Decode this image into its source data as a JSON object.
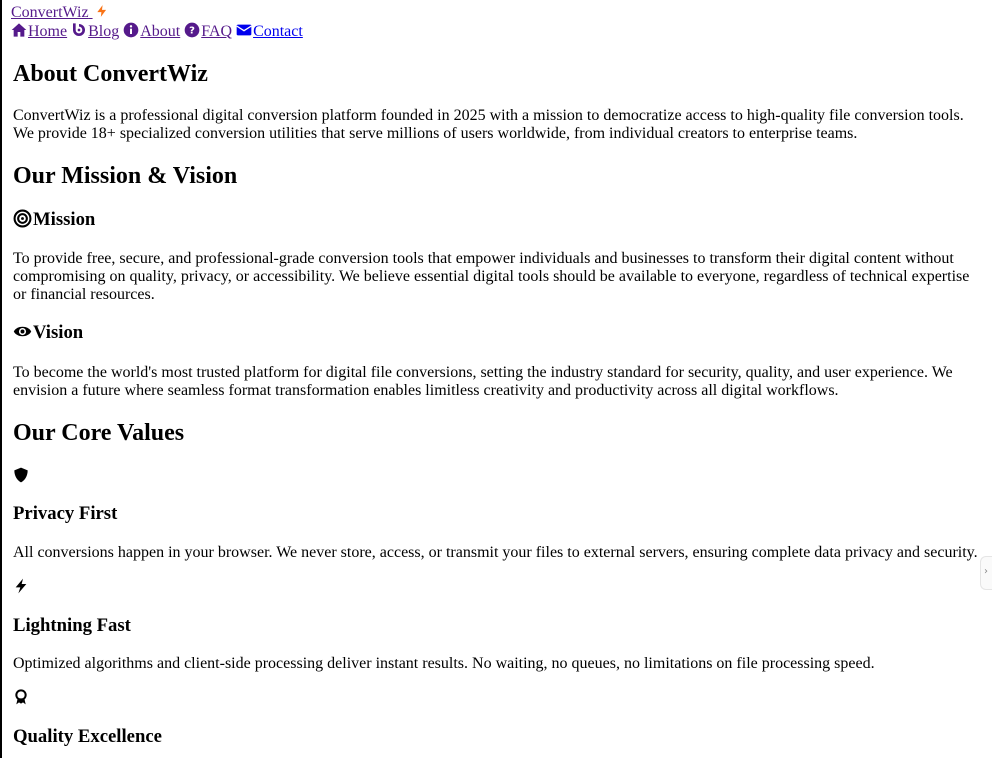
{
  "header": {
    "logo_text": "ConvertWiz",
    "nav": [
      {
        "label": "Home",
        "icon": "home-icon"
      },
      {
        "label": "Blog",
        "icon": "blog-icon"
      },
      {
        "label": "About",
        "icon": "info-icon"
      },
      {
        "label": "FAQ",
        "icon": "question-icon"
      },
      {
        "label": "Contact",
        "icon": "envelope-icon"
      }
    ]
  },
  "about": {
    "title": "About ConvertWiz",
    "intro": "ConvertWiz is a professional digital conversion platform founded in 2025 with a mission to democratize access to high-quality file conversion tools. We provide 18+ specialized conversion utilities that serve millions of users worldwide, from individual creators to enterprise teams."
  },
  "mission_vision": {
    "title": "Our Mission & Vision",
    "mission_title": "Mission",
    "mission_text": "To provide free, secure, and professional-grade conversion tools that empower individuals and businesses to transform their digital content without compromising on quality, privacy, or accessibility. We believe essential digital tools should be available to everyone, regardless of technical expertise or financial resources.",
    "vision_title": "Vision",
    "vision_text": "To become the world's most trusted platform for digital file conversions, setting the industry standard for security, quality, and user experience. We envision a future where seamless format transformation enables limitless creativity and productivity across all digital workflows."
  },
  "values": {
    "title": "Our Core Values",
    "items": [
      {
        "icon": "shield-icon",
        "title": "Privacy First",
        "text": "All conversions happen in your browser. We never store, access, or transmit your files to external servers, ensuring complete data privacy and security."
      },
      {
        "icon": "bolt-icon",
        "title": "Lightning Fast",
        "text": "Optimized algorithms and client-side processing deliver instant results. No waiting, no queues, no limitations on file processing speed."
      },
      {
        "icon": "award-icon",
        "title": "Quality Excellence",
        "text": ""
      }
    ]
  },
  "colors": {
    "link_visited": "#551a8b",
    "link": "#0000ee",
    "logo_bolt": "#f97316"
  }
}
